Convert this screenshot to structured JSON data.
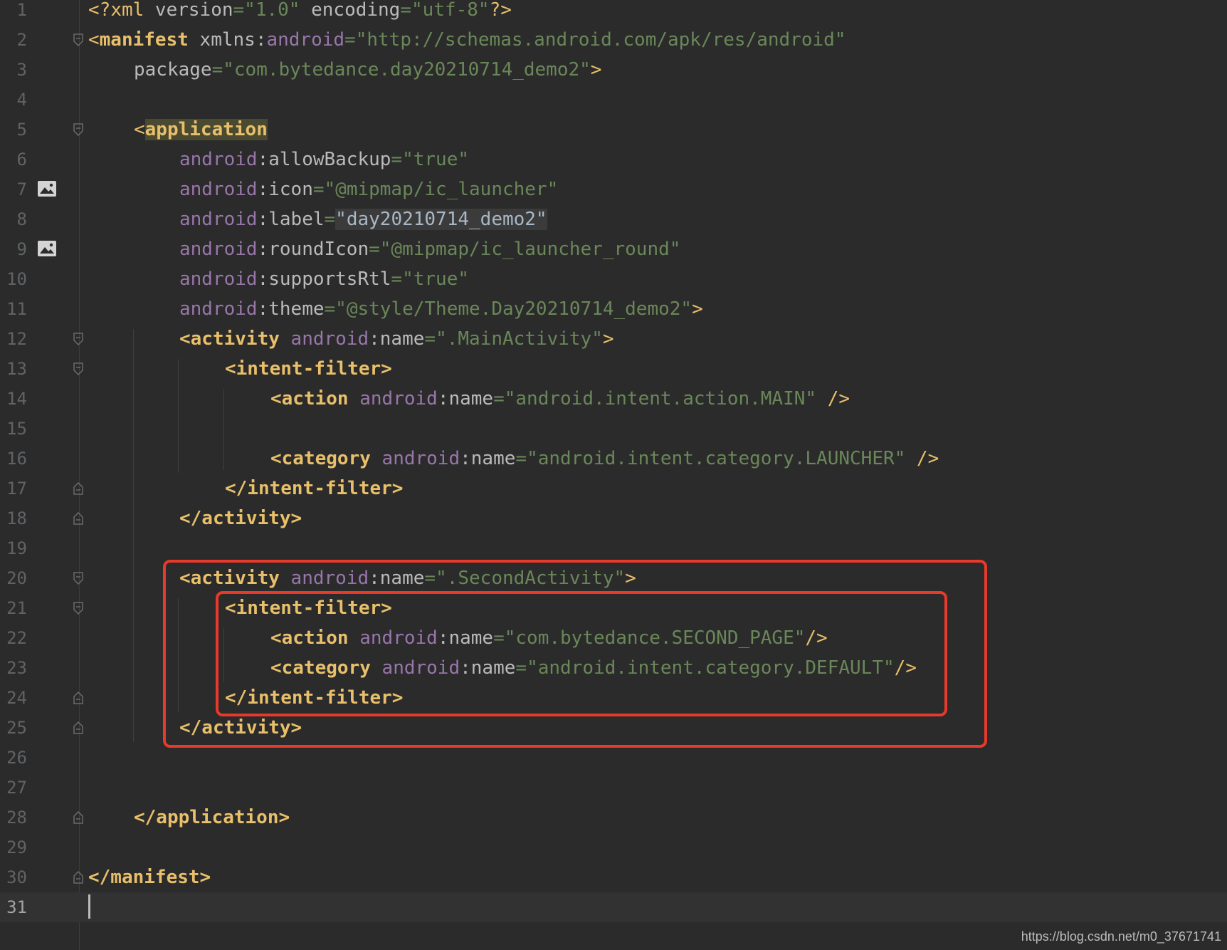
{
  "editor": {
    "file_language": "xml",
    "current_line": "31",
    "lines": [
      {
        "n": "1"
      },
      {
        "n": "2"
      },
      {
        "n": "3"
      },
      {
        "n": "4"
      },
      {
        "n": "5"
      },
      {
        "n": "6"
      },
      {
        "n": "7"
      },
      {
        "n": "8"
      },
      {
        "n": "9"
      },
      {
        "n": "10"
      },
      {
        "n": "11"
      },
      {
        "n": "12"
      },
      {
        "n": "13"
      },
      {
        "n": "14"
      },
      {
        "n": "15"
      },
      {
        "n": "16"
      },
      {
        "n": "17"
      },
      {
        "n": "18"
      },
      {
        "n": "19"
      },
      {
        "n": "20"
      },
      {
        "n": "21"
      },
      {
        "n": "22"
      },
      {
        "n": "23"
      },
      {
        "n": "24"
      },
      {
        "n": "25"
      },
      {
        "n": "26"
      },
      {
        "n": "27"
      },
      {
        "n": "28"
      },
      {
        "n": "29"
      },
      {
        "n": "30"
      },
      {
        "n": "31"
      }
    ],
    "code": {
      "l1": {
        "open": "<?",
        "tag": "xml",
        "a1": " version",
        "eq1": "=",
        "v1": "\"1.0\"",
        "a2": " encoding",
        "eq2": "=",
        "v2": "\"utf-8\"",
        "close": "?>"
      },
      "l2": {
        "open": "<",
        "tag": "manifest",
        "a1": " xmlns",
        "colon": ":",
        "ns": "android",
        "eq": "=",
        "v": "\"http://schemas.android.com/apk/res/android\""
      },
      "l3": {
        "attr": "package",
        "eq": "=",
        "v": "\"com.bytedance.day20210714_demo2\"",
        "close": ">"
      },
      "l5": {
        "open": "<",
        "tag": "application"
      },
      "l6": {
        "ns": "android",
        "colon": ":",
        "attr": "allowBackup",
        "eq": "=",
        "v": "\"true\""
      },
      "l7": {
        "ns": "android",
        "colon": ":",
        "attr": "icon",
        "eq": "=",
        "v": "\"@mipmap/ic_launcher\""
      },
      "l8": {
        "ns": "android",
        "colon": ":",
        "attr": "label",
        "eq": "=",
        "v": "\"day20210714_demo2\""
      },
      "l9": {
        "ns": "android",
        "colon": ":",
        "attr": "roundIcon",
        "eq": "=",
        "v": "\"@mipmap/ic_launcher_round\""
      },
      "l10": {
        "ns": "android",
        "colon": ":",
        "attr": "supportsRtl",
        "eq": "=",
        "v": "\"true\""
      },
      "l11": {
        "ns": "android",
        "colon": ":",
        "attr": "theme",
        "eq": "=",
        "v": "\"@style/Theme.Day20210714_demo2\"",
        "close": ">"
      },
      "l12": {
        "open": "<activity",
        "ns": " android",
        "colon": ":",
        "attr": "name",
        "eq": "=",
        "v": "\".MainActivity\"",
        "close": ">"
      },
      "l13": {
        "tag": "<intent-filter>"
      },
      "l14": {
        "open": "<action",
        "ns": " android",
        "colon": ":",
        "attr": "name",
        "eq": "=",
        "v": "\"android.intent.action.MAIN\"",
        "close": " />"
      },
      "l16": {
        "open": "<category",
        "ns": " android",
        "colon": ":",
        "attr": "name",
        "eq": "=",
        "v": "\"android.intent.category.LAUNCHER\"",
        "close": " />"
      },
      "l17": {
        "tag": "</intent-filter>"
      },
      "l18": {
        "tag": "</activity>"
      },
      "l20": {
        "open": "<activity",
        "ns": " android",
        "colon": ":",
        "attr": "name",
        "eq": "=",
        "v": "\".SecondActivity\"",
        "close": ">"
      },
      "l21": {
        "tag": "<intent-filter>"
      },
      "l22": {
        "open": "<action",
        "ns": " android",
        "colon": ":",
        "attr": "name",
        "eq": "=",
        "v": "\"com.bytedance.SECOND_PAGE\"",
        "close": "/>"
      },
      "l23": {
        "open": "<category",
        "ns": " android",
        "colon": ":",
        "attr": "name",
        "eq": "=",
        "v": "\"android.intent.category.DEFAULT\"",
        "close": "/>"
      },
      "l24": {
        "tag": "</intent-filter>"
      },
      "l25": {
        "tag": "</activity>"
      },
      "l28": {
        "tag": "</application>"
      },
      "l30": {
        "tag": "</manifest>"
      }
    }
  },
  "annotations": {
    "highlight_color": "#e8392a"
  },
  "watermark": "https://blog.csdn.net/m0_37671741",
  "colors": {
    "background": "#2b2b2b",
    "tag": "#e8bf6a",
    "namespace": "#9876aa",
    "attribute": "#bababa",
    "value": "#6a8759",
    "line_number": "#606366"
  }
}
